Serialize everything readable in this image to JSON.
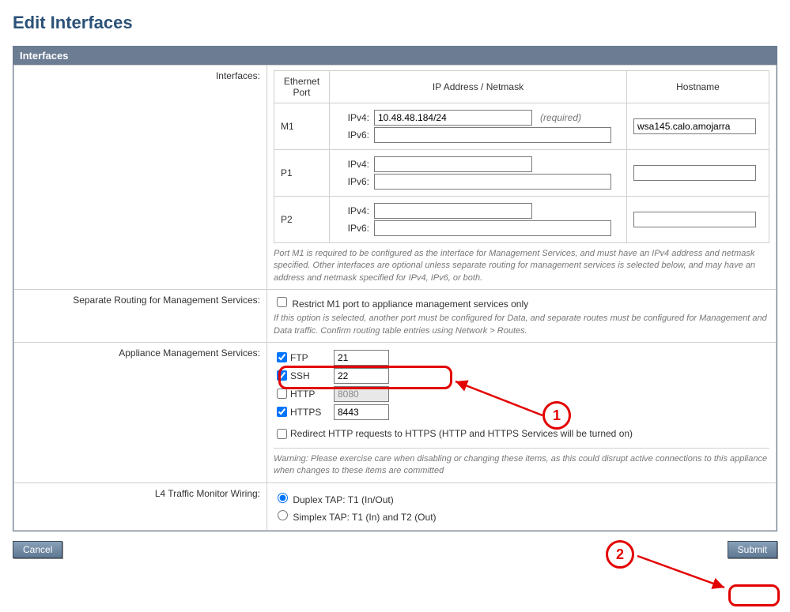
{
  "page": {
    "title": "Edit Interfaces"
  },
  "panel": {
    "header": "Interfaces"
  },
  "labels": {
    "interfaces": "Interfaces:",
    "separate_routing": "Separate Routing for Management Services:",
    "appliance_services": "Appliance Management Services:",
    "l4_wiring": "L4 Traffic Monitor Wiring:"
  },
  "iface_headers": {
    "port": "Ethernet Port",
    "ip": "IP Address / Netmask",
    "hostname": "Hostname"
  },
  "ports": {
    "m1": {
      "name": "M1",
      "ipv4_label": "IPv4:",
      "ipv4": "10.48.48.184/24",
      "ipv4_required": "(required)",
      "ipv6_label": "IPv6:",
      "ipv6": "",
      "hostname": "wsa145.calo.amojarra"
    },
    "p1": {
      "name": "P1",
      "ipv4_label": "IPv4:",
      "ipv4": "",
      "ipv6_label": "IPv6:",
      "ipv6": "",
      "hostname": ""
    },
    "p2": {
      "name": "P2",
      "ipv4_label": "IPv4:",
      "ipv4": "",
      "ipv6_label": "IPv6:",
      "ipv6": "",
      "hostname": ""
    }
  },
  "hints": {
    "port_m1": "Port M1 is required to be configured as the interface for Management Services, and must have an IPv4 address and netmask specified. Other interfaces are optional unless separate routing for management services is selected below, and may have an address and netmask specified for IPv4, IPv6, or both.",
    "restrict_m1": "If this option is selected, another port must be configured for Data, and separate routes must be configured for Management and Data traffic. Confirm routing table entries using Network > Routes.",
    "warning": "Warning: Please exercise care when disabling or changing these items, as this could disrupt active connections to this appliance when changes to these items are committed"
  },
  "restrict_m1": {
    "label": "Restrict M1 port to appliance management services only"
  },
  "services": {
    "ftp": {
      "label": "FTP",
      "port": "21",
      "checked": true
    },
    "ssh": {
      "label": "SSH",
      "port": "22",
      "checked": true
    },
    "http": {
      "label": "HTTP",
      "port": "8080",
      "checked": false
    },
    "https": {
      "label": "HTTPS",
      "port": "8443",
      "checked": true
    },
    "redirect": {
      "label": "Redirect HTTP requests to HTTPS (HTTP and HTTPS Services will be turned on)"
    }
  },
  "l4": {
    "duplex": "Duplex TAP: T1 (In/Out)",
    "simplex": "Simplex TAP: T1 (In) and T2 (Out)"
  },
  "buttons": {
    "cancel": "Cancel",
    "submit": "Submit"
  },
  "annotations": {
    "n1": "1",
    "n2": "2"
  }
}
